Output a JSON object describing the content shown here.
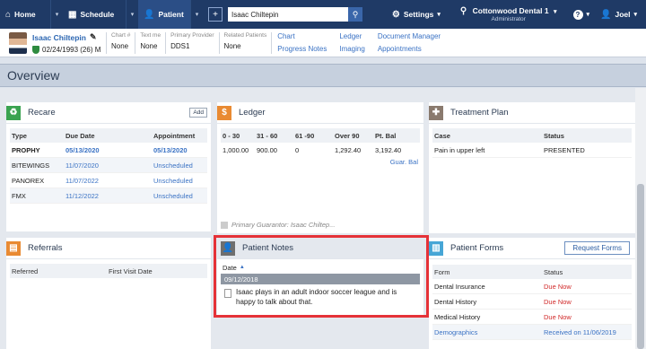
{
  "navbar": {
    "home": "Home",
    "schedule": "Schedule",
    "patient": "Patient",
    "plus": "+",
    "search_value": "Isaac Chiltepin",
    "settings": "Settings",
    "location": "Cottonwood Dental 1",
    "location_role": "Administrator",
    "help": "?",
    "user": "Joel",
    "caret": "▾"
  },
  "patient": {
    "name": "Isaac Chiltepin",
    "dob": "02/24/1993 (26) M",
    "chart_label": "Chart #",
    "chart_value": "None",
    "textme_label": "Text me",
    "textme_value": "None",
    "provider_label": "Primary Provider",
    "provider_value": "DDS1",
    "related_label": "Related Patients",
    "related_value": "None",
    "links": [
      "Chart",
      "Ledger",
      "Document Manager",
      "Progress Notes",
      "Imaging",
      "Appointments"
    ]
  },
  "overview_title": "Overview",
  "recare": {
    "title": "Recare",
    "add_label": "Add",
    "headers": [
      "Type",
      "Due Date",
      "Appointment"
    ],
    "rows": [
      {
        "type": "PROPHY",
        "due": "05/13/2020",
        "appt": "05/13/2020"
      },
      {
        "type": "BITEWINGS",
        "due": "11/07/2020",
        "appt": "Unscheduled"
      },
      {
        "type": "PANOREX",
        "due": "11/07/2022",
        "appt": "Unscheduled"
      },
      {
        "type": "FMX",
        "due": "11/12/2022",
        "appt": "Unscheduled"
      }
    ]
  },
  "ledger": {
    "title": "Ledger",
    "icon": "$",
    "headers": [
      "0 - 30",
      "31 - 60",
      "61 -90",
      "Over 90",
      "Pt. Bal"
    ],
    "values": [
      "1,000.00",
      "900.00",
      "0",
      "1,292.40",
      "3,192.40"
    ],
    "guar_bal": "Guar. Bal",
    "guarantor": "Primary Guarantor: Isaac Chiltep..."
  },
  "treatment": {
    "title": "Treatment Plan",
    "headers": [
      "Case",
      "Status"
    ],
    "rows": [
      {
        "case": "Pain in upper left",
        "status": "PRESENTED"
      }
    ]
  },
  "referrals": {
    "title": "Referrals",
    "headers": [
      "Referred",
      "First Visit Date"
    ]
  },
  "notes": {
    "title": "Patient Notes",
    "sort_label": "Date",
    "sort_arrow": "▲",
    "date": "09/12/2018",
    "note": "Isaac plays in an adult indoor soccer league and is happy to talk about that."
  },
  "forms": {
    "title": "Patient Forms",
    "request_label": "Request Forms",
    "headers": [
      "Form",
      "Status"
    ],
    "rows": [
      {
        "form": "Dental Insurance",
        "status": "Due Now"
      },
      {
        "form": "Dental History",
        "status": "Due Now"
      },
      {
        "form": "Medical History",
        "status": "Due Now"
      },
      {
        "form": "Demographics",
        "status": "Received on 11/06/2019"
      }
    ]
  },
  "colors": {
    "nav": "#1f3a66",
    "recare_icon": "#3aa350",
    "ledger_icon": "#e98a32",
    "treatment_icon": "#8a7a6e",
    "referrals_icon": "#e98a32",
    "notes_icon": "#6f6f6f",
    "forms_icon": "#47a6d6",
    "highlight": "#e53238"
  }
}
